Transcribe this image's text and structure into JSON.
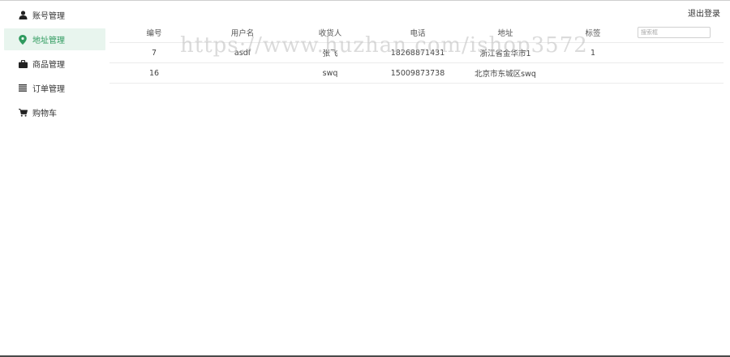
{
  "sidebar": {
    "items": [
      {
        "label": "账号管理",
        "icon": "user-icon",
        "active": false
      },
      {
        "label": "地址管理",
        "icon": "location-pin-icon",
        "active": true
      },
      {
        "label": "商品管理",
        "icon": "briefcase-icon",
        "active": false
      },
      {
        "label": "订单管理",
        "icon": "list-icon",
        "active": false
      },
      {
        "label": "购物车",
        "icon": "cart-icon",
        "active": false
      }
    ]
  },
  "header": {
    "logout_label": "退出登录"
  },
  "table": {
    "columns": [
      "编号",
      "用户名",
      "收货人",
      "电话",
      "地址",
      "标签"
    ],
    "search_placeholder": "搜索框",
    "rows": [
      {
        "id": "7",
        "username": "asdf",
        "receiver": "张飞",
        "phone": "18268871431",
        "address": "浙江省金华市1",
        "tag": "1"
      },
      {
        "id": "16",
        "username": "",
        "receiver": "swq",
        "phone": "15009873738",
        "address": "北京市东城区swq",
        "tag": ""
      }
    ]
  },
  "watermark": "https://www.huzhan.com/ishop3572",
  "colors": {
    "accent": "#2e9a5e",
    "active_bg": "#e8f5ee"
  }
}
